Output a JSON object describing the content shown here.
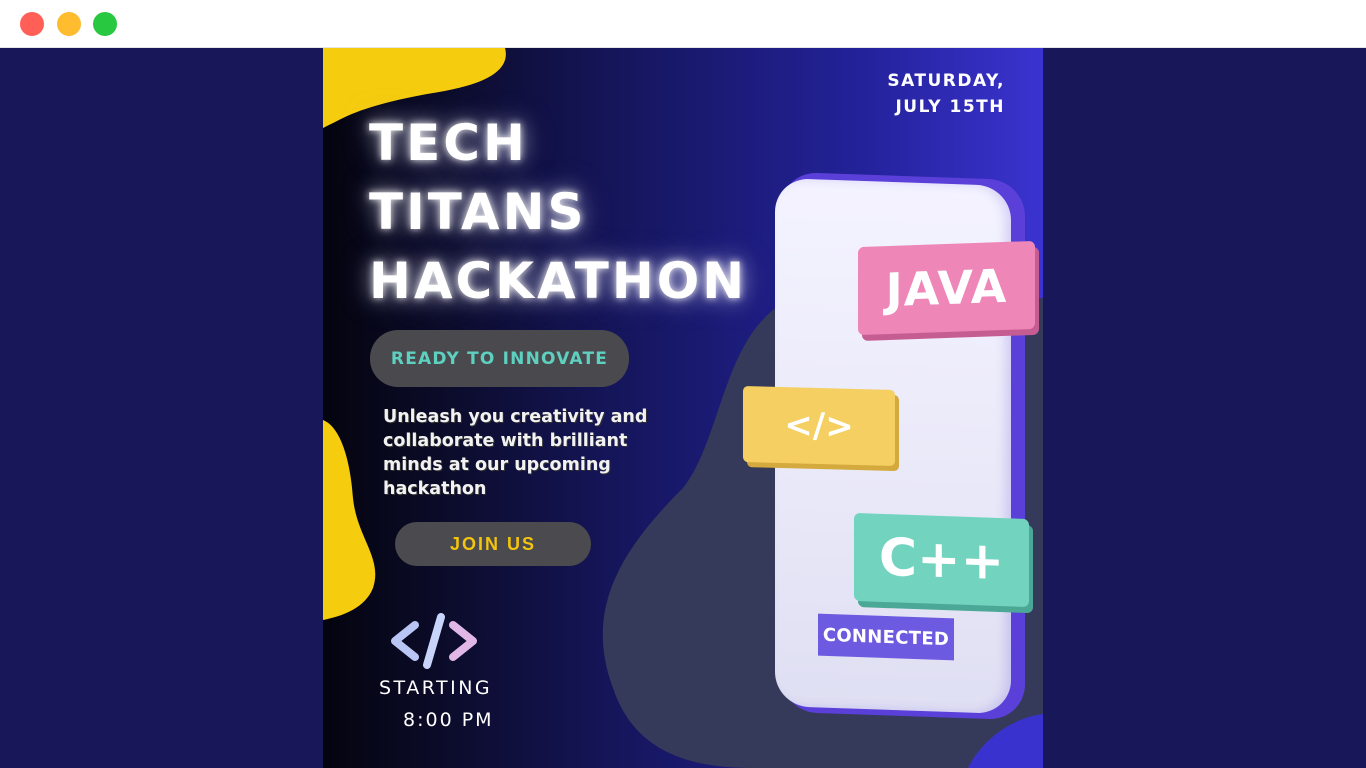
{
  "window": {
    "controls": [
      "close",
      "minimize",
      "maximize"
    ]
  },
  "poster": {
    "date_line1": "SATURDAY,",
    "date_line2": "JULY 15TH",
    "title_line1": "TECH",
    "title_line2": "TITANS",
    "title_line3": "HACKATHON",
    "tagline": "READY TO INNOVATE",
    "blurb": "Unleash you creativity and collaborate with brilliant minds at our upcoming hackathon",
    "cta": "JOIN US",
    "start_label": "STARTING",
    "start_time": "8:00 PM",
    "tags": {
      "java": "JAVA",
      "code": "</>",
      "cpp": "C++",
      "connected": "CONNECTED"
    }
  },
  "colors": {
    "accent_yellow": "#f2c40f",
    "teal": "#5ed0c0",
    "java_pink": "#ee86b8",
    "code_yellow": "#f5cf62",
    "cpp_green": "#72d3bf",
    "connected_purple": "#6c5be0"
  }
}
